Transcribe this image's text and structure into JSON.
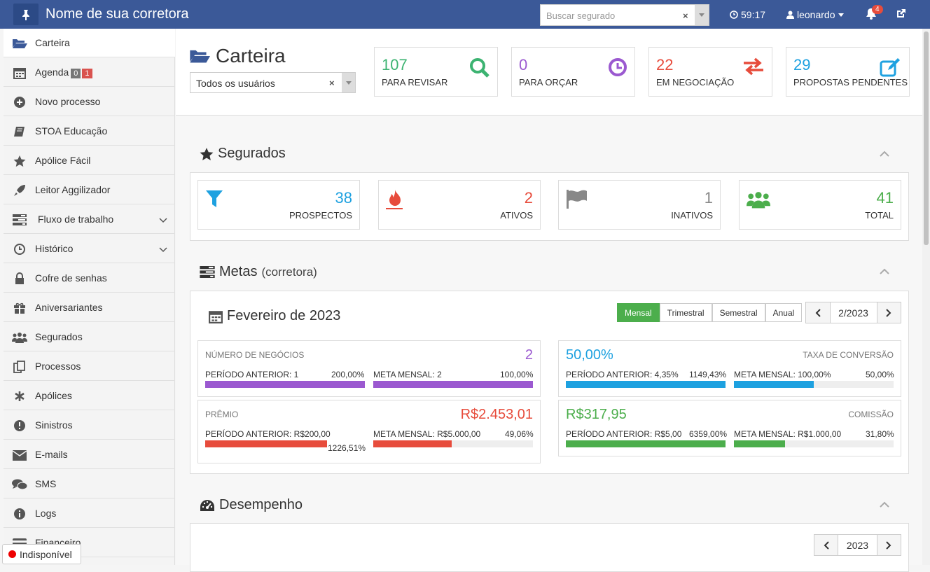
{
  "topbar": {
    "brand": "Nome de sua corretora",
    "search_placeholder": "Buscar segurado",
    "timer": "59:17",
    "user": "leonardo",
    "notifications": "4"
  },
  "sidebar": {
    "items": [
      {
        "label": "Carteira",
        "icon": "folder-open-icon"
      },
      {
        "label": "Agenda",
        "icon": "calendar-icon",
        "badge_a": "0",
        "badge_b": "1"
      },
      {
        "label": "Novo processo",
        "icon": "plus-circle-icon"
      },
      {
        "label": "STOA Educação",
        "icon": "book-icon"
      },
      {
        "label": "Apólice Fácil",
        "icon": "star-icon"
      },
      {
        "label": "Leitor Aggilizador",
        "icon": "rocket-icon"
      },
      {
        "label": "Fluxo de trabalho",
        "icon": "tasks-icon"
      },
      {
        "label": "Histórico",
        "icon": "history-icon"
      },
      {
        "label": "Cofre de senhas",
        "icon": "lock-icon"
      },
      {
        "label": "Aniversariantes",
        "icon": "gift-icon"
      },
      {
        "label": "Segurados",
        "icon": "users-icon"
      },
      {
        "label": "Processos",
        "icon": "copy-icon"
      },
      {
        "label": "Apólices",
        "icon": "asterisk-icon"
      },
      {
        "label": "Sinistros",
        "icon": "exclamation-circle-icon"
      },
      {
        "label": "E-mails",
        "icon": "envelope-icon"
      },
      {
        "label": "SMS",
        "icon": "comments-icon"
      },
      {
        "label": "Logs",
        "icon": "info-circle-icon"
      },
      {
        "label": "Financeiro",
        "icon": "credit-card-icon"
      }
    ],
    "status": "Indisponível"
  },
  "header": {
    "title": "Carteira",
    "user_select": "Todos os usuários",
    "kpis": [
      {
        "value": "107",
        "label": "PARA REVISAR",
        "color": "#3cb371"
      },
      {
        "value": "0",
        "label": "PARA ORÇAR",
        "color": "#9b59d0"
      },
      {
        "value": "22",
        "label": "EM NEGOCIAÇÃO",
        "color": "#e74c3c"
      },
      {
        "value": "29",
        "label": "PROPOSTAS PENDENTES",
        "color": "#1ea1e0"
      }
    ]
  },
  "segurados": {
    "title": "Segurados",
    "cards": [
      {
        "value": "38",
        "label": "PROSPECTOS",
        "color": "#1ea1e0"
      },
      {
        "value": "2",
        "label": "ATIVOS",
        "color": "#e74c3c"
      },
      {
        "value": "1",
        "label": "INATIVOS",
        "color": "#888888"
      },
      {
        "value": "41",
        "label": "TOTAL",
        "color": "#4cae4c"
      }
    ]
  },
  "metas": {
    "title": "Metas",
    "subtitle": "(corretora)",
    "month": "Fevereiro de 2023",
    "periods": [
      "Mensal",
      "Trimestral",
      "Semestral",
      "Anual"
    ],
    "period_value": "2/2023",
    "negocios": {
      "title": "NÚMERO DE NEGÓCIOS",
      "value": "2",
      "prev_label": "PERÍODO ANTERIOR: 1",
      "prev_pct": "200,00%",
      "prev_fill": 1.0,
      "meta_label": "META MENSAL: 2",
      "meta_pct": "100,00%",
      "meta_fill": 1.0
    },
    "conversao": {
      "title": "TAXA DE CONVERSÃO",
      "value": "50,00%",
      "prev_label": "PERÍODO ANTERIOR: 4,35%",
      "prev_pct": "1149,43%",
      "prev_fill": 1.0,
      "meta_label": "META MENSAL: 100,00%",
      "meta_pct": "50,00%",
      "meta_fill": 0.5
    },
    "premio": {
      "title": "PRÊMIO",
      "value": "R$2.453,01",
      "prev_label": "PERÍODO ANTERIOR: R$200,00",
      "prev_pct": "1226,51%",
      "prev_fill": 1.0,
      "meta_label": "META MENSAL: R$5.000,00",
      "meta_pct": "49,06%",
      "meta_fill": 0.4906
    },
    "comissao": {
      "title": "COMISSÃO",
      "value": "R$317,95",
      "prev_label": "PERÍODO ANTERIOR: R$5,00",
      "prev_pct": "6359,00%",
      "prev_fill": 1.0,
      "meta_label": "META MENSAL: R$1.000,00",
      "meta_pct": "31,80%",
      "meta_fill": 0.318
    }
  },
  "desempenho": {
    "title": "Desempenho",
    "year": "2023"
  }
}
